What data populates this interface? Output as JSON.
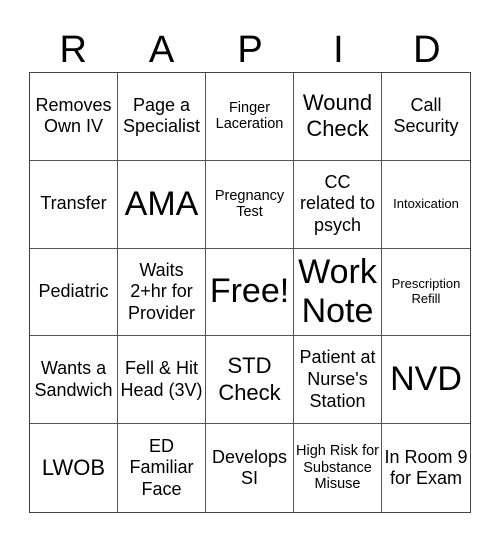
{
  "title_letters": [
    "R",
    "A",
    "P",
    "I",
    "D"
  ],
  "rows": [
    [
      {
        "text": "Removes Own IV",
        "size": "md"
      },
      {
        "text": "Page a Specialist",
        "size": "md"
      },
      {
        "text": "Finger Laceration",
        "size": "sm"
      },
      {
        "text": "Wound Check",
        "size": "lg"
      },
      {
        "text": "Call Security",
        "size": "md"
      }
    ],
    [
      {
        "text": "Transfer",
        "size": "md"
      },
      {
        "text": "AMA",
        "size": "xl"
      },
      {
        "text": "Pregnancy Test",
        "size": "sm"
      },
      {
        "text": "CC related to psych",
        "size": "md"
      },
      {
        "text": "Intoxication",
        "size": "xs"
      }
    ],
    [
      {
        "text": "Pediatric",
        "size": "md"
      },
      {
        "text": "Waits 2+hr for Provider",
        "size": "md"
      },
      {
        "text": "Free!",
        "size": "xl"
      },
      {
        "text": "Work Note",
        "size": "xl"
      },
      {
        "text": "Prescription Refill",
        "size": "xs"
      }
    ],
    [
      {
        "text": "Wants a Sandwich",
        "size": "md"
      },
      {
        "text": "Fell & Hit Head (3V)",
        "size": "md"
      },
      {
        "text": "STD Check",
        "size": "lg"
      },
      {
        "text": "Patient at Nurse's Station",
        "size": "md"
      },
      {
        "text": "NVD",
        "size": "xl"
      }
    ],
    [
      {
        "text": "LWOB",
        "size": "lg"
      },
      {
        "text": "ED Familiar Face",
        "size": "md"
      },
      {
        "text": "Develops SI",
        "size": "md"
      },
      {
        "text": "High Risk for Substance Misuse",
        "size": "sm"
      },
      {
        "text": "In Room 9 for Exam",
        "size": "md"
      }
    ]
  ]
}
